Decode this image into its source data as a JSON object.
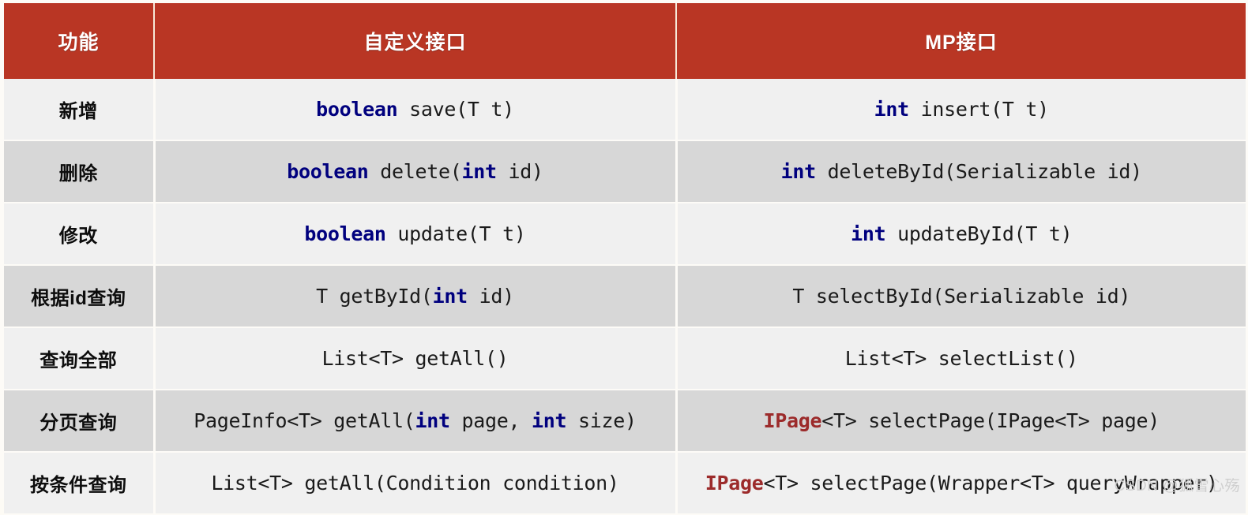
{
  "table": {
    "headers": [
      {
        "label": "功能"
      },
      {
        "label": "自定义接口"
      },
      {
        "label": "MP接口"
      }
    ],
    "rows": [
      {
        "feature": "新增",
        "custom": "boolean save(T t)",
        "mp": "int insert(T t)",
        "custom_tokens": [
          {
            "text": "boolean",
            "style": "kw"
          },
          {
            "text": " save(T t)",
            "style": "plain"
          }
        ],
        "mp_tokens": [
          {
            "text": "int",
            "style": "kw"
          },
          {
            "text": " insert(T t)",
            "style": "plain"
          }
        ]
      },
      {
        "feature": "删除",
        "custom": "boolean delete(int id)",
        "mp": "int deleteById(Serializable id)",
        "custom_tokens": [
          {
            "text": "boolean",
            "style": "kw"
          },
          {
            "text": " delete(",
            "style": "plain"
          },
          {
            "text": "int",
            "style": "kw"
          },
          {
            "text": " id)",
            "style": "plain"
          }
        ],
        "mp_tokens": [
          {
            "text": "int",
            "style": "kw"
          },
          {
            "text": " deleteById(Serializable id)",
            "style": "plain"
          }
        ]
      },
      {
        "feature": "修改",
        "custom": "boolean update(T t)",
        "mp": "int updateById(T t)",
        "custom_tokens": [
          {
            "text": "boolean",
            "style": "kw"
          },
          {
            "text": " update(T t)",
            "style": "plain"
          }
        ],
        "mp_tokens": [
          {
            "text": "int",
            "style": "kw"
          },
          {
            "text": " updateById(T t)",
            "style": "plain"
          }
        ]
      },
      {
        "feature": "根据id查询",
        "custom": "T getById(int id)",
        "mp": "T selectById(Serializable id)",
        "custom_tokens": [
          {
            "text": "T getById(",
            "style": "plain"
          },
          {
            "text": "int",
            "style": "kw"
          },
          {
            "text": " id)",
            "style": "plain"
          }
        ],
        "mp_tokens": [
          {
            "text": "T selectById(Serializable id)",
            "style": "plain"
          }
        ]
      },
      {
        "feature": "查询全部",
        "custom": "List<T> getAll()",
        "mp": "List<T> selectList()",
        "custom_tokens": [
          {
            "text": "List<T> getAll()",
            "style": "plain"
          }
        ],
        "mp_tokens": [
          {
            "text": "List<T> selectList()",
            "style": "plain"
          }
        ]
      },
      {
        "feature": "分页查询",
        "custom": "PageInfo<T> getAll(int page, int size)",
        "mp": "IPage<T> selectPage(IPage<T> page)",
        "custom_tokens": [
          {
            "text": "PageInfo<T> getAll(",
            "style": "plain"
          },
          {
            "text": "int",
            "style": "kw"
          },
          {
            "text": " page, ",
            "style": "plain"
          },
          {
            "text": "int",
            "style": "kw"
          },
          {
            "text": " size)",
            "style": "plain"
          }
        ],
        "mp_tokens": [
          {
            "text": "IPage",
            "style": "tp"
          },
          {
            "text": "<T> selectPage(IPage<T> page)",
            "style": "plain"
          }
        ]
      },
      {
        "feature": "按条件查询",
        "custom": "List<T> getAll(Condition condition)",
        "mp": "IPage<T> selectPage(Wrapper<T> queryWrapper)",
        "custom_tokens": [
          {
            "text": "List<T> getAll(Condition condition)",
            "style": "plain"
          }
        ],
        "mp_tokens": [
          {
            "text": "IPage",
            "style": "tp"
          },
          {
            "text": "<T> selectPage(Wrapper<T> queryWrapper)",
            "style": "plain"
          }
        ]
      }
    ]
  },
  "watermark": {
    "text": "CSDN @狐雪心殇"
  },
  "colors": {
    "header_bg": "#b93624",
    "header_text": "#ffffff",
    "row_light": "#f0f0f0",
    "row_dark": "#d7d7d7",
    "keyword": "#00007e",
    "type_accent": "#9c2b2b",
    "page_bg": "#fdfbf7"
  }
}
